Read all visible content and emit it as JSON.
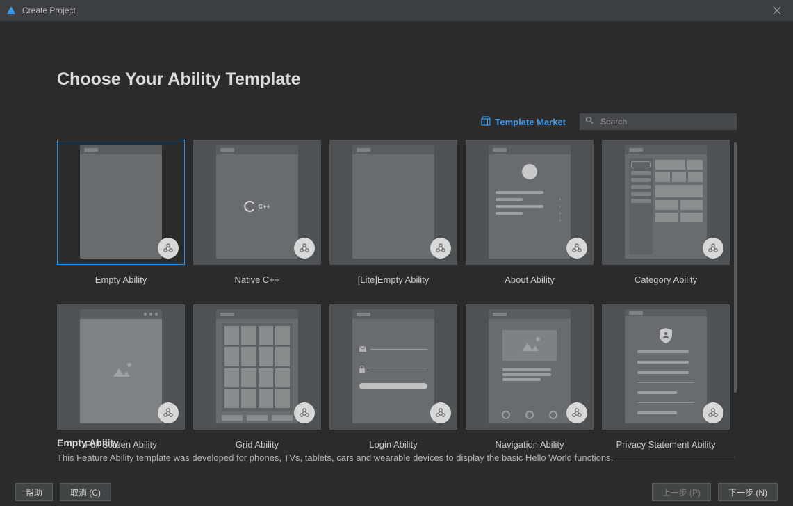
{
  "window": {
    "title": "Create Project"
  },
  "heading": "Choose Your Ability Template",
  "market_link": "Template Market",
  "search": {
    "placeholder": "Search",
    "value": ""
  },
  "templates": [
    {
      "label": "Empty Ability"
    },
    {
      "label": "Native C++"
    },
    {
      "label": "[Lite]Empty Ability"
    },
    {
      "label": "About Ability"
    },
    {
      "label": "Category Ability"
    },
    {
      "label": "Full Screen Ability"
    },
    {
      "label": "Grid Ability"
    },
    {
      "label": "Login Ability"
    },
    {
      "label": "Navigation Ability"
    },
    {
      "label": "Privacy Statement Ability"
    }
  ],
  "native_cpp_text": "C++",
  "description": {
    "title": "Empty Ability",
    "text": "This Feature Ability template was developed for phones, TVs, tablets, cars and wearable devices to display the basic Hello World functions."
  },
  "footer": {
    "help": "帮助",
    "cancel": "取消 (C)",
    "prev": "上一步 (P)",
    "next": "下一步 (N)"
  }
}
